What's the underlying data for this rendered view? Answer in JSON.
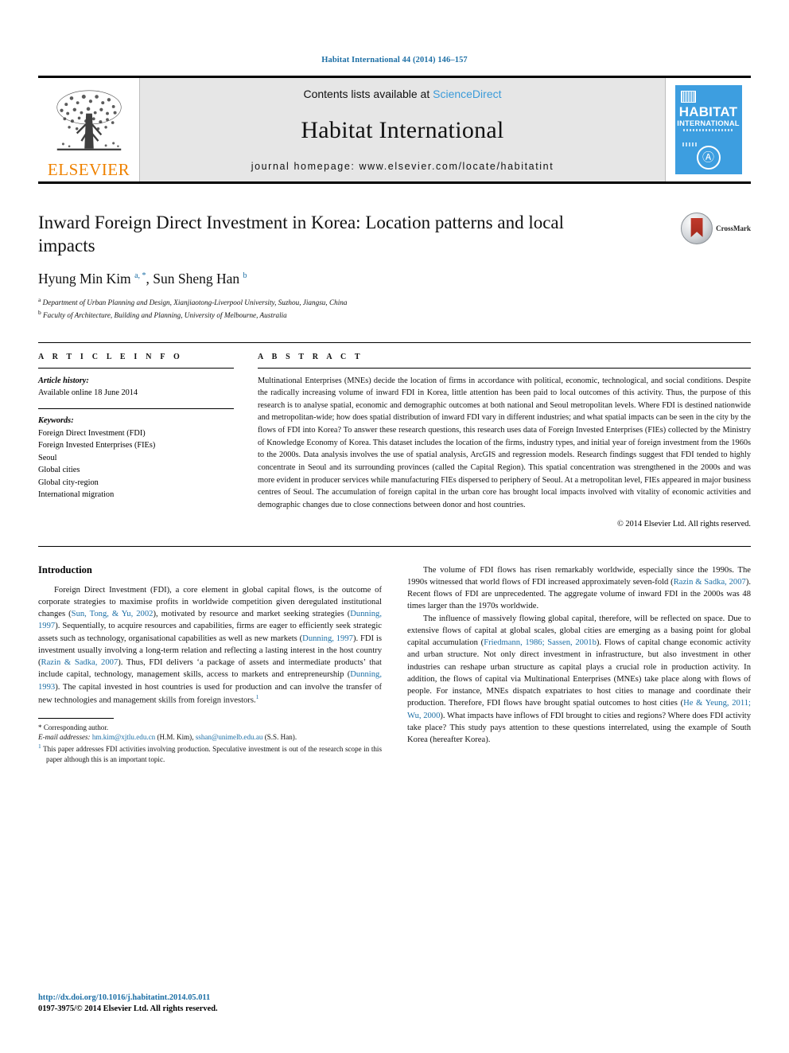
{
  "running_head": "Habitat International 44 (2014) 146–157",
  "masthead": {
    "publisher_logo_label": "ELSEVIER",
    "contents_prefix": "Contents lists available at ",
    "contents_link": "ScienceDirect",
    "journal_title": "Habitat International",
    "homepage_line": "journal homepage: www.elsevier.com/locate/habitatint",
    "cover": {
      "line1": "HABITAT",
      "line2": "INTERNATIONAL",
      "emblem_glyph": "Ⓐ"
    }
  },
  "article": {
    "title": "Inward Foreign Direct Investment in Korea: Location patterns and local impacts",
    "authors_html": "Hyung Min Kim <sup>a, *</sup>, Sun Sheng Han <sup>b</sup>",
    "affiliations": [
      {
        "marker": "a",
        "text": "Department of Urban Planning and Design, Xianjiaotong-Liverpool University, Suzhou, Jiangsu, China"
      },
      {
        "marker": "b",
        "text": "Faculty of Architecture, Building and Planning, University of Melbourne, Australia"
      }
    ],
    "crossmark_label": "CrossMark"
  },
  "article_info": {
    "heading": "A R T I C L E  I N F O",
    "history_label": "Article history:",
    "history_value": "Available online 18 June 2014",
    "keywords_label": "Keywords:",
    "keywords": [
      "Foreign Direct Investment (FDI)",
      "Foreign Invested Enterprises (FIEs)",
      "Seoul",
      "Global cities",
      "Global city-region",
      "International migration"
    ]
  },
  "abstract": {
    "heading": "A B S T R A C T",
    "text": "Multinational Enterprises (MNEs) decide the location of firms in accordance with political, economic, technological, and social conditions. Despite the radically increasing volume of inward FDI in Korea, little attention has been paid to local outcomes of this activity. Thus, the purpose of this research is to analyse spatial, economic and demographic outcomes at both national and Seoul metropolitan levels. Where FDI is destined nationwide and metropolitan-wide; how does spatial distribution of inward FDI vary in different industries; and what spatial impacts can be seen in the city by the flows of FDI into Korea? To answer these research questions, this research uses data of Foreign Invested Enterprises (FIEs) collected by the Ministry of Knowledge Economy of Korea. This dataset includes the location of the firms, industry types, and initial year of foreign investment from the 1960s to the 2000s. Data analysis involves the use of spatial analysis, ArcGIS and regression models. Research findings suggest that FDI tended to highly concentrate in Seoul and its surrounding provinces (called the Capital Region). This spatial concentration was strengthened in the 2000s and was more evident in producer services while manufacturing FIEs dispersed to periphery of Seoul. At a metropolitan level, FIEs appeared in major business centres of Seoul. The accumulation of foreign capital in the urban core has brought local impacts involved with vitality of economic activities and demographic changes due to close connections between donor and host countries.",
    "copyright": "© 2014 Elsevier Ltd. All rights reserved."
  },
  "introduction": {
    "heading": "Introduction",
    "left_paragraph_html": "Foreign Direct Investment (FDI), a core element in global capital flows, is the outcome of corporate strategies to maximise profits in worldwide competition given deregulated institutional changes (<span class=\"ref\">Sun, Tong, &amp; Yu, 2002</span>), motivated by resource and market seeking strategies (<span class=\"ref\">Dunning, 1997</span>). Sequentially, to acquire resources and capabilities, firms are eager to efficiently seek strategic assets such as technology, organisational capabilities as well as new markets (<span class=\"ref\">Dunning, 1997</span>). FDI is investment usually involving a long-term relation and reflecting a lasting interest in the host country (<span class=\"ref\">Razin &amp; Sadka, 2007</span>). Thus, FDI delivers ‘a package of assets and intermediate products’ that include capital, technology, management skills, access to markets and entrepreneurship (<span class=\"ref\">Dunning, 1993</span>). The capital invested in host countries is used for production and can involve the transfer of new technologies and management skills from foreign investors.<sup class=\"fn\">1</sup>",
    "right_paragraph_1_html": "The volume of FDI flows has risen remarkably worldwide, especially since the 1990s. The 1990s witnessed that world flows of FDI increased approximately seven-fold (<span class=\"ref\">Razin &amp; Sadka, 2007</span>). Recent flows of FDI are unprecedented. The aggregate volume of inward FDI in the 2000s was 48 times larger than the 1970s worldwide.",
    "right_paragraph_2_html": "The influence of massively flowing global capital, therefore, will be reflected on space. Due to extensive flows of capital at global scales, global cities are emerging as a basing point for global capital accumulation (<span class=\"ref\">Friedmann, 1986; Sassen, 2001b</span>). Flows of capital change economic activity and urban structure. Not only direct investment in infrastructure, but also investment in other industries can reshape urban structure as capital plays a crucial role in production activity. In addition, the flows of capital via Multinational Enterprises (MNEs) take place along with flows of people. For instance, MNEs dispatch expatriates to host cities to manage and coordinate their production. Therefore, FDI flows have brought spatial outcomes to host cities (<span class=\"ref\">He &amp; Yeung, 2011; Wu, 2000</span>). What impacts have inflows of FDI brought to cities and regions? Where does FDI activity take place? This study pays attention to these questions interrelated, using the example of South Korea (hereafter Korea)."
  },
  "footnotes": {
    "corresponding_html": "* Corresponding author.",
    "email_html": "<span class=\"it\">E-mail addresses:</span> <span class=\"mail\">hm.kim@xjtlu.edu.cn</span> (H.M. Kim), <span class=\"mail\">sshan@unimelb.edu.au</span> (S.S. Han).",
    "note_1_html": "<sup class=\"fn\">1</sup> This paper addresses FDI activities involving production. Speculative investment is out of the research scope in this paper although this is an important topic."
  },
  "footer": {
    "doi": "http://dx.doi.org/10.1016/j.habitatint.2014.05.011",
    "issn_line": "0197-3975/© 2014 Elsevier Ltd. All rights reserved."
  },
  "colors": {
    "link_blue": "#1d6fa5",
    "sciencedirect_blue": "#3a9bd9",
    "elsevier_orange": "#ef8200",
    "cover_blue": "#3d9ee0",
    "band_grey": "#e6e6e6"
  }
}
